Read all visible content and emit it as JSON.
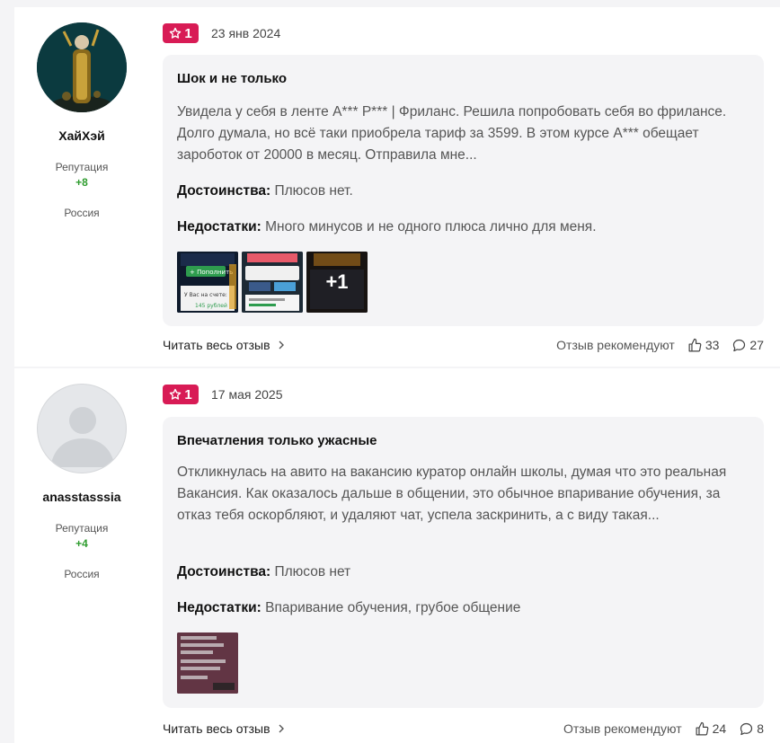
{
  "reviews": [
    {
      "author": {
        "name": "ХайХэй",
        "reputation_label": "Репутация",
        "reputation_value": "+8",
        "country": "Россия"
      },
      "rating": "1",
      "date": "23 янв 2024",
      "title": "Шок и не только",
      "excerpt": "Увидела у себя в ленте А*** Р*** | Фриланс. Решила попробовать себя во фрилансе. Долго думала, но всё таки приобрела тариф за 3599. В этом курсе А*** обещает зароботок от 20000 в месяц. Отправила мне...",
      "pros_label": "Достоинства:",
      "pros_text": "Плюсов нет.",
      "cons_label": "Недостатки:",
      "cons_text": "Много минусов и не одного плюса лично для меня.",
      "thumbnails": [
        {
          "text_lines": [
            "+ Пополнить",
            "У Вас на счете:",
            "145 рублей"
          ]
        },
        {
          "text_lines": []
        },
        {
          "more_label": "+1"
        }
      ],
      "read_more": "Читать весь отзыв",
      "recommend_label": "Отзыв рекомендуют",
      "likes": "33",
      "comments": "27"
    },
    {
      "author": {
        "name": "anasstasssia",
        "reputation_label": "Репутация",
        "reputation_value": "+4",
        "country": "Россия"
      },
      "rating": "1",
      "date": "17 мая 2025",
      "title": "Впечатления только ужасные",
      "excerpt": "Откликнулась на авито на вакансию куратор онлайн школы, думая что это реальная Вакансия. Как оказалось дальше в общении, это обычное впаривание обучения, за отказ тебя оскорбляют, и удаляют чат, успела заскринить, а с виду такая...",
      "pros_label": "Достоинства:",
      "pros_text": "Плюсов нет",
      "cons_label": "Недостатки:",
      "cons_text": "Впаривание обучения, грубое общение",
      "thumbnails": [
        {
          "text_lines": []
        }
      ],
      "read_more": "Читать весь отзыв",
      "recommend_label": "Отзыв рекомендуют",
      "likes": "24",
      "comments": "8"
    }
  ],
  "colors": {
    "rating_badge": "#d81b55",
    "reputation_positive": "#2e9c2e",
    "card_background": "#f4f4f6"
  },
  "icons": {
    "rating": "star-icon",
    "read_more": "chevron-right-icon",
    "likes": "thumbs-up-icon",
    "comments": "comment-bubble-icon"
  }
}
